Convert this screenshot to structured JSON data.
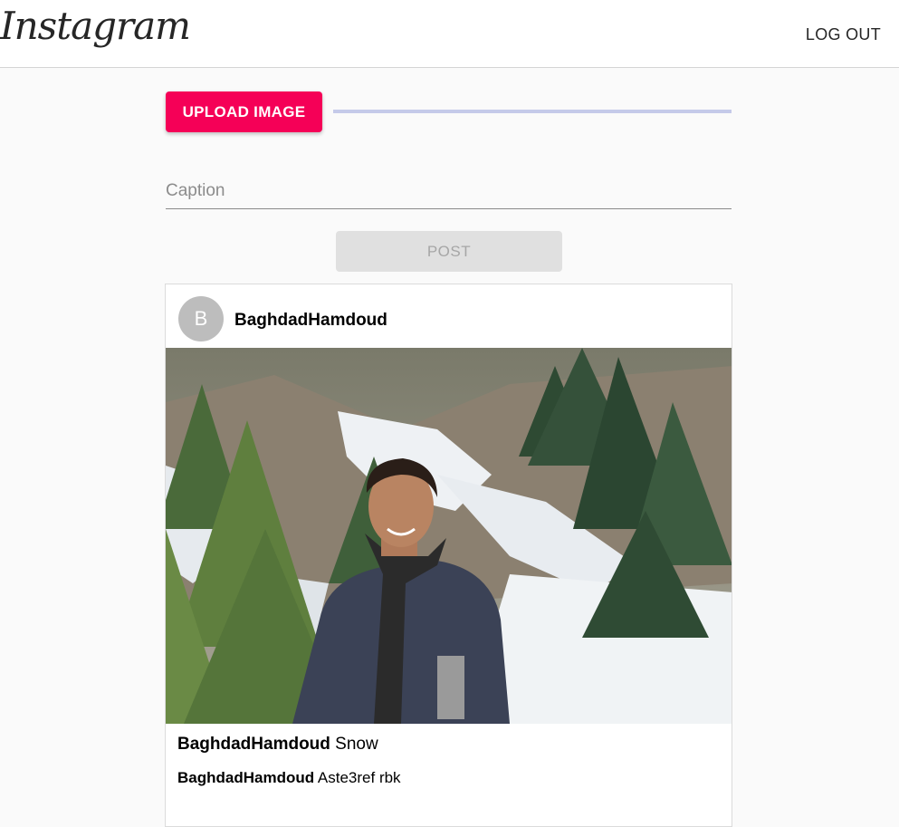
{
  "header": {
    "logo_text": "Instagram",
    "logout_label": "LOG OUT"
  },
  "upload": {
    "upload_label": "UPLOAD IMAGE",
    "progress": 1.0,
    "caption_placeholder": "Caption",
    "caption_value": "",
    "post_label": "POST"
  },
  "post": {
    "avatar_letter": "B",
    "author": "BaghdadHamdoud",
    "caption_author": "BaghdadHamdoud",
    "caption_text": "Snow",
    "comments": [
      {
        "user": "BaghdadHamdoud",
        "text": "Aste3ref rbk"
      }
    ]
  },
  "colors": {
    "accent": "#f50057",
    "progress": "#c5cae9"
  }
}
